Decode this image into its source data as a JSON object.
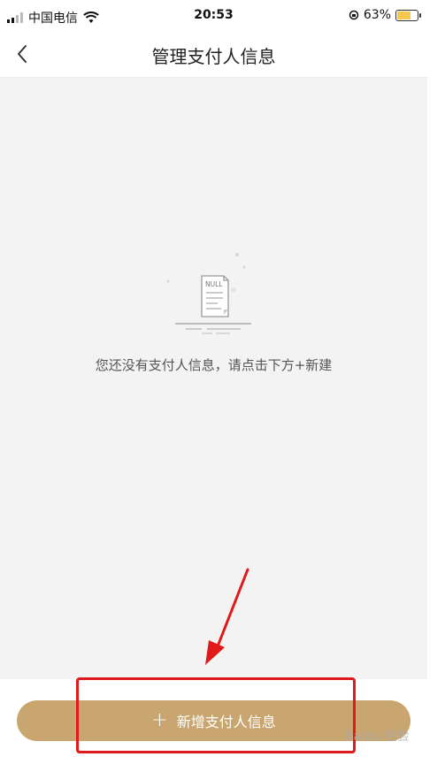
{
  "status_bar": {
    "carrier": "中国电信",
    "time": "20:53",
    "battery_text": "63%",
    "battery_level": 0.63,
    "icons": [
      "signal-icon",
      "wifi-icon",
      "rotation-lock-icon",
      "battery-icon"
    ]
  },
  "nav": {
    "title": "管理支付人信息",
    "back_icon": "chevron-left-icon"
  },
  "empty_state": {
    "badge_text": "NULL",
    "message": "您还没有支付人信息，请点击下方+新建"
  },
  "bottom": {
    "add_button_label": "新增支付人信息",
    "plus_icon": "+"
  },
  "annotation": {
    "arrow_color": "#e0191a",
    "box_color": "#e0191a"
  },
  "watermark": {
    "text": "Baidu 经验"
  },
  "colors": {
    "accent": "#c9a670",
    "background": "#f3f3f3"
  }
}
